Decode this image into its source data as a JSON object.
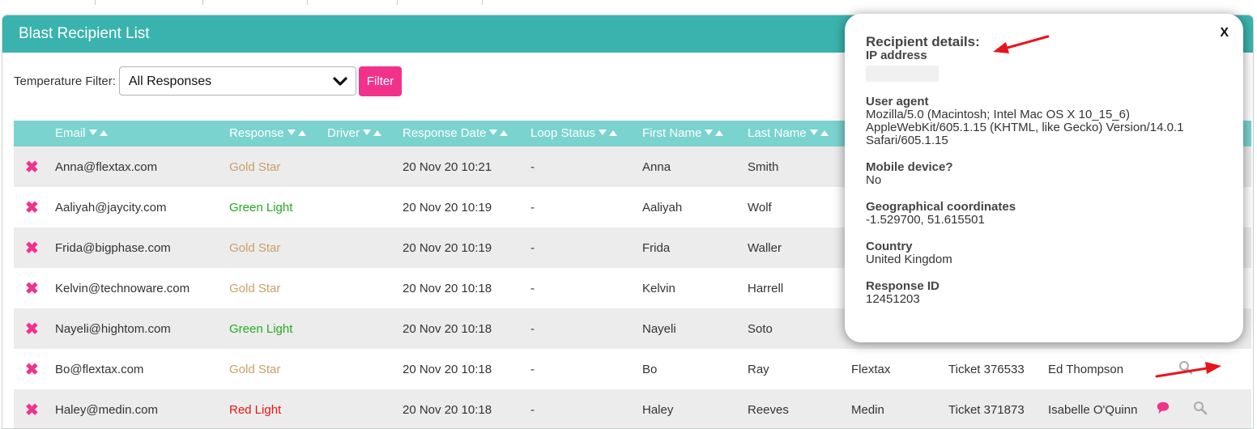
{
  "header": {
    "title": "Blast Recipient List"
  },
  "filter": {
    "label": "Temperature Filter:",
    "selected": "All Responses",
    "button": "Filter"
  },
  "columns": [
    "Email",
    "Response",
    "Driver",
    "Response Date",
    "Loop Status",
    "First Name",
    "Last Name"
  ],
  "rows": [
    {
      "email": "Anna@flextax.com",
      "response": "Gold Star",
      "date": "20 Nov 20 10:21",
      "loop": "-",
      "first": "Anna",
      "last": "Smith",
      "company": "",
      "ticket": "",
      "owner": ""
    },
    {
      "email": "Aaliyah@jaycity.com",
      "response": "Green Light",
      "date": "20 Nov 20 10:19",
      "loop": "-",
      "first": "Aaliyah",
      "last": "Wolf",
      "company": "",
      "ticket": "",
      "owner": ""
    },
    {
      "email": "Frida@bigphase.com",
      "response": "Gold Star",
      "date": "20 Nov 20 10:19",
      "loop": "-",
      "first": "Frida",
      "last": "Waller",
      "company": "",
      "ticket": "",
      "owner": ""
    },
    {
      "email": "Kelvin@technoware.com",
      "response": "Gold Star",
      "date": "20 Nov 20 10:18",
      "loop": "-",
      "first": "Kelvin",
      "last": "Harrell",
      "company": "",
      "ticket": "",
      "owner": ""
    },
    {
      "email": "Nayeli@hightom.com",
      "response": "Green Light",
      "date": "20 Nov 20 10:18",
      "loop": "-",
      "first": "Nayeli",
      "last": "Soto",
      "company": "",
      "ticket": "",
      "owner": ""
    },
    {
      "email": "Bo@flextax.com",
      "response": "Gold Star",
      "date": "20 Nov 20 10:18",
      "loop": "-",
      "first": "Bo",
      "last": "Ray",
      "company": "Flextax",
      "ticket": "Ticket 376533",
      "owner": "Ed Thompson"
    },
    {
      "email": "Haley@medin.com",
      "response": "Red Light",
      "date": "20 Nov 20 10:18",
      "loop": "-",
      "first": "Haley",
      "last": "Reeves",
      "company": "Medin",
      "ticket": "Ticket 371873",
      "owner": "Isabelle O'Quinn"
    }
  ],
  "popup": {
    "title": "Recipient details:",
    "close": "X",
    "ip_label": "IP address",
    "ua_label": "User agent",
    "ua_line1": "Mozilla/5.0 (Macintosh; Intel Mac OS X 10_15_6)",
    "ua_line2": "AppleWebKit/605.1.15 (KHTML, like Gecko) Version/14.0.1",
    "ua_line3": "Safari/605.1.15",
    "mobile_label": "Mobile device?",
    "mobile_value": "No",
    "geo_label": "Geographical coordinates",
    "geo_value": "-1.529700, 51.615501",
    "country_label": "Country",
    "country_value": "United Kingdom",
    "rid_label": "Response ID",
    "rid_value": "12451203"
  },
  "colors": {
    "header": "#3ab3ae",
    "table_header": "#7ad3cf",
    "accent": "#f2328a",
    "gold": "#c8a064",
    "green": "#22aa22",
    "red": "#ee1111",
    "annotation_arrow": "#e8141c"
  },
  "icons": {
    "delete": "close-x-icon",
    "details": "magnifier-icon",
    "comment": "speech-bubble-icon",
    "sort": "sort-arrows-icon",
    "select": "chevron-down-icon"
  }
}
